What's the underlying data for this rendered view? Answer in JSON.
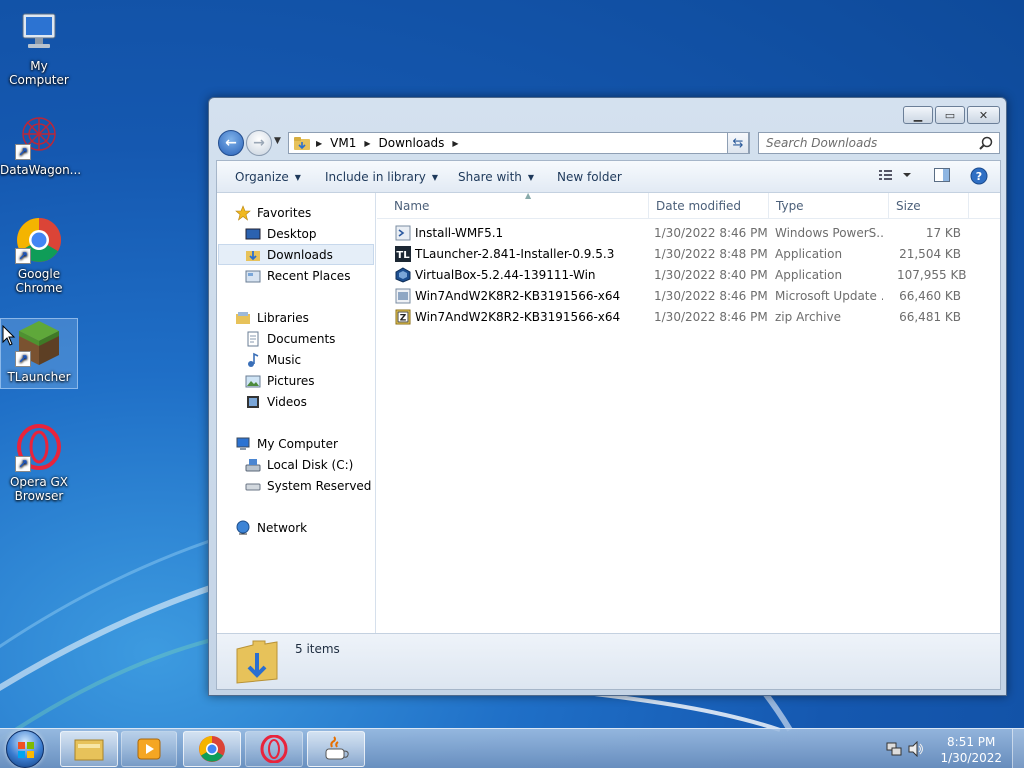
{
  "desktop": {
    "icons": [
      {
        "label": "My Computer"
      },
      {
        "label": "DataWagon..."
      },
      {
        "label": "Google Chrome"
      },
      {
        "label": "TLauncher"
      },
      {
        "label": "Opera GX Browser"
      }
    ]
  },
  "window": {
    "breadcrumb": [
      "VM1",
      "Downloads"
    ],
    "search_placeholder": "Search Downloads",
    "toolbar": {
      "organize": "Organize",
      "include_in_library": "Include in library",
      "share_with": "Share with",
      "new_folder": "New folder"
    },
    "nav": {
      "favorites": "Favorites",
      "desktop": "Desktop",
      "downloads": "Downloads",
      "recent_places": "Recent Places",
      "libraries": "Libraries",
      "documents": "Documents",
      "music": "Music",
      "pictures": "Pictures",
      "videos": "Videos",
      "my_computer": "My Computer",
      "local_disk": "Local Disk (C:)",
      "system_reserved": "System Reserved (M",
      "network": "Network"
    },
    "columns": {
      "name": "Name",
      "date": "Date modified",
      "type": "Type",
      "size": "Size"
    },
    "files": [
      {
        "name": "Install-WMF5.1",
        "date": "1/30/2022 8:46 PM",
        "type": "Windows PowerS...",
        "size": "17 KB",
        "icon": "powershell-script-icon"
      },
      {
        "name": "TLauncher-2.841-Installer-0.9.5.3",
        "date": "1/30/2022 8:48 PM",
        "type": "Application",
        "size": "21,504 KB",
        "icon": "tlauncher-app-icon"
      },
      {
        "name": "VirtualBox-5.2.44-139111-Win",
        "date": "1/30/2022 8:40 PM",
        "type": "Application",
        "size": "107,955 KB",
        "icon": "virtualbox-app-icon"
      },
      {
        "name": "Win7AndW2K8R2-KB3191566-x64",
        "date": "1/30/2022 8:46 PM",
        "type": "Microsoft Update ...",
        "size": "66,460 KB",
        "icon": "msu-update-icon"
      },
      {
        "name": "Win7AndW2K8R2-KB3191566-x64",
        "date": "1/30/2022 8:46 PM",
        "type": "zip Archive",
        "size": "66,481 KB",
        "icon": "zip-archive-icon"
      }
    ],
    "status": "5 items"
  },
  "taskbar": {
    "time": "8:51 PM",
    "date": "1/30/2022"
  },
  "colors": {
    "desktop_blue": "#1558b0",
    "selection": "#e5eef8",
    "link_text": "#1e395b"
  }
}
